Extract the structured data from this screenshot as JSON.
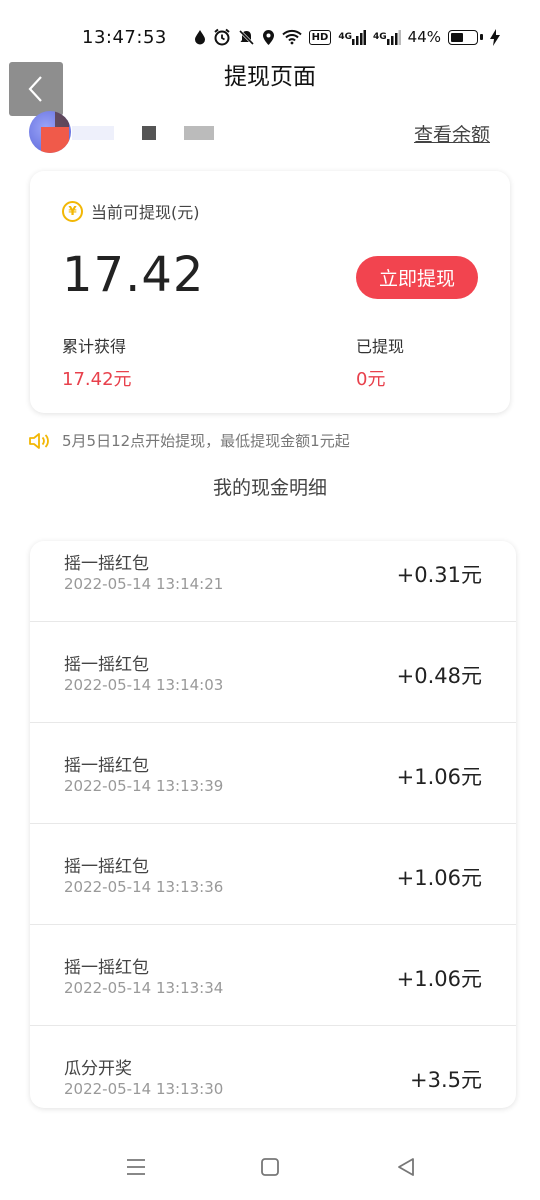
{
  "status_bar": {
    "time": "13:47:53",
    "hd_label": "HD",
    "signal1_label": "4G",
    "signal2_label": "4G",
    "battery_percent": "44%",
    "battery_level": 0.44
  },
  "header": {
    "title": "提现页面"
  },
  "user": {
    "balance_link": "查看余额"
  },
  "balance_card": {
    "label": "当前可提现(元)",
    "amount": "17.42",
    "withdraw_button": "立即提现",
    "total_earned_label": "累计获得",
    "total_earned_value": "17.42元",
    "withdrawn_label": "已提现",
    "withdrawn_value": "0元"
  },
  "notice": {
    "text": "5月5日12点开始提现，最低提现金额1元起"
  },
  "records_section": {
    "title": "我的现金明细"
  },
  "records": [
    {
      "title": "摇一摇红包",
      "time": "2022-05-14 13:14:21",
      "amount": "+0.31元"
    },
    {
      "title": "摇一摇红包",
      "time": "2022-05-14 13:14:03",
      "amount": "+0.48元"
    },
    {
      "title": "摇一摇红包",
      "time": "2022-05-14 13:13:39",
      "amount": "+1.06元"
    },
    {
      "title": "摇一摇红包",
      "time": "2022-05-14 13:13:36",
      "amount": "+1.06元"
    },
    {
      "title": "摇一摇红包",
      "time": "2022-05-14 13:13:34",
      "amount": "+1.06元"
    },
    {
      "title": "瓜分开奖",
      "time": "2022-05-14 13:13:30",
      "amount": "+3.5元"
    }
  ],
  "colors": {
    "accent_red": "#f2444f",
    "value_red": "#e8414c",
    "coin_yellow": "#f2b705"
  }
}
